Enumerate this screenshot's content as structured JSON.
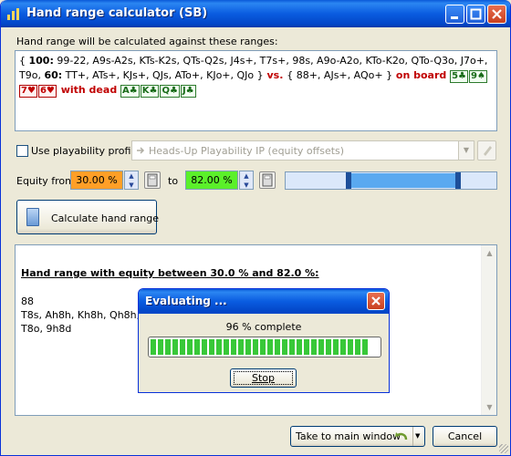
{
  "window": {
    "title": "Hand range calculator (SB)"
  },
  "ranges": {
    "label": "Hand range will be calculated against these ranges:",
    "open_brace": "{ ",
    "weight1": "100:",
    "range1": " 99-22, A9s-A2s, KTs-K2s, QTs-Q2s, J4s+, T7s+, 98s, A9o-A2o, KTo-K2o, QTo-Q3o, J7o+, T9o, ",
    "weight2": "60:",
    "range2": " TT+, ATs+, KJs+, QJs, ATo+, KJo+, QJo }",
    "vs": " vs. ",
    "range3": "{ 88+, AJs+, AQo+ }",
    "on_board": " on board ",
    "board": [
      {
        "text": "5♣",
        "red": false
      },
      {
        "text": "9♠",
        "red": false
      },
      {
        "text": "7♥",
        "red": true
      },
      {
        "text": "6♥",
        "red": true
      }
    ],
    "with_dead": " with dead ",
    "dead": [
      {
        "text": "A♣",
        "red": false
      },
      {
        "text": "K♣",
        "red": false
      },
      {
        "text": "Q♣",
        "red": false
      },
      {
        "text": "J♣",
        "red": false
      }
    ]
  },
  "playability": {
    "checkbox_label": "Use playability profile:",
    "profile": "Heads-Up Playability IP  (equity offsets)"
  },
  "equity": {
    "from_label": "Equity from",
    "from_value": "30.00 %",
    "to_label": "to",
    "to_value": "82.00 %",
    "from_color": "#ff9f27",
    "to_color": "#5bf02a",
    "slider_from": 0.3,
    "slider_to": 0.82
  },
  "calc_button": "Calculate hand range",
  "result": {
    "heading": "Hand range with equity between 30.0 % and 82.0 %:",
    "lines": [
      "88",
      "T8s, Ah8h, Kh8h, Qh8h,",
      "T8o, 9h8d"
    ]
  },
  "dialog": {
    "title": "Evaluating ...",
    "status": "96 % complete",
    "progress": 0.96,
    "stop": "Stop"
  },
  "footer": {
    "main_window": "Take to main window",
    "cancel": "Cancel"
  }
}
